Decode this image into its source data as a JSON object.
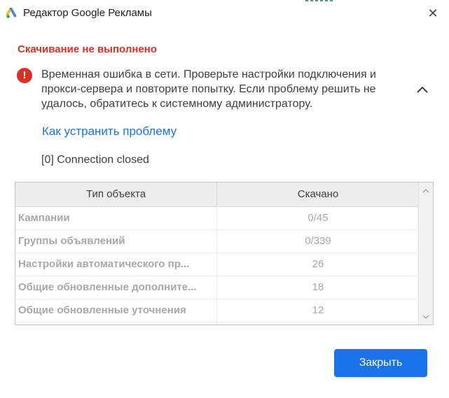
{
  "window": {
    "title": "Редактор Google Рекламы",
    "close_glyph": "✕"
  },
  "error": {
    "title": "Скачивание не выполнено",
    "icon_glyph": "!",
    "message": "Временная ошибка в сети. Проверьте настройки подключения и прокси-сервера и повторите попытку. Если проблему решить не удалось, обратитесь к системному администратору.",
    "help_link": "Как устранить проблему",
    "detail": "[0] Connection closed"
  },
  "table": {
    "headers": [
      "Тип объекта",
      "Скачано"
    ],
    "rows": [
      {
        "type": "Кампании",
        "downloaded": "0/45"
      },
      {
        "type": "Группы объявлений",
        "downloaded": "0/339"
      },
      {
        "type": "Настройки автоматического пр...",
        "downloaded": "26"
      },
      {
        "type": "Общие обновленные дополните...",
        "downloaded": "18"
      },
      {
        "type": "Общие обновленные уточнения",
        "downloaded": "12"
      }
    ]
  },
  "footer": {
    "close_label": "Закрыть"
  },
  "colors": {
    "error": "#d93025",
    "link": "#1a73e8",
    "primary_button": "#1a73e8",
    "table_header_bg": "#ededed",
    "disabled_text": "#a8a8a8"
  },
  "icons": [
    "google-ads-logo-icon",
    "close-icon",
    "error-circle-icon",
    "chevron-up-icon",
    "scroll-up-arrow-icon",
    "scroll-down-arrow-icon"
  ]
}
